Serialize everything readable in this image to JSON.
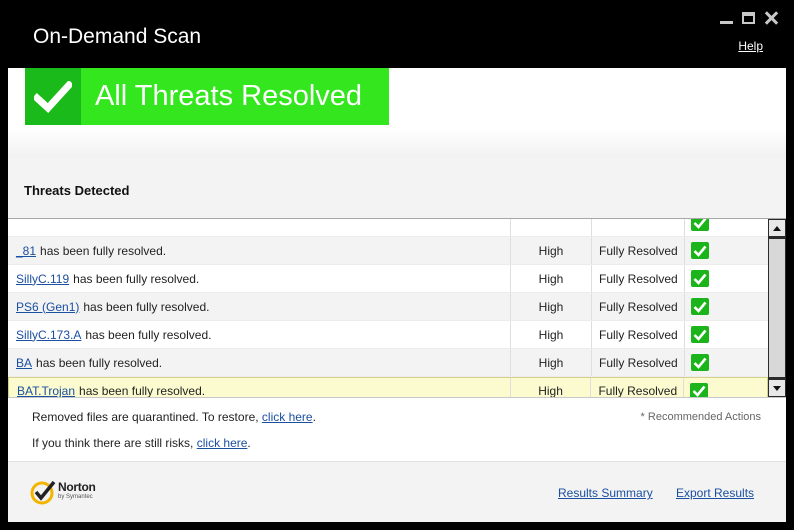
{
  "window": {
    "title": "On-Demand Scan",
    "help_label": "Help"
  },
  "banner": {
    "text": "All Threats Resolved",
    "color": "#33e61e"
  },
  "section": {
    "title": "Threats Detected"
  },
  "threats": [
    {
      "name": "",
      "message": "",
      "severity": "",
      "status": ""
    },
    {
      "name": "_81",
      "message": "has been fully resolved.",
      "severity": "High",
      "status": "Fully Resolved"
    },
    {
      "name": "SillyC.119",
      "message": "has been fully resolved.",
      "severity": "High",
      "status": "Fully Resolved"
    },
    {
      "name": "PS6 (Gen1)",
      "message": "has been fully resolved.",
      "severity": "High",
      "status": "Fully Resolved"
    },
    {
      "name": "SillyC.173.A",
      "message": "has been fully resolved.",
      "severity": "High",
      "status": "Fully Resolved"
    },
    {
      "name": "BA",
      "message": "has been fully resolved.",
      "severity": "High",
      "status": "Fully Resolved"
    },
    {
      "name": "BAT.Trojan",
      "message": "has been fully resolved.",
      "severity": "High",
      "status": "Fully Resolved"
    }
  ],
  "notes": {
    "quarantine_text": "Removed files are quarantined. To restore,",
    "quarantine_link": "click here",
    "risk_text": "If you think there are still risks,",
    "risk_link": "click here",
    "recommended": "* Recommended Actions"
  },
  "footer": {
    "brand": "Norton",
    "brand_sub": "by Symantec",
    "results_summary": "Results Summary",
    "export_results": "Export Results"
  }
}
